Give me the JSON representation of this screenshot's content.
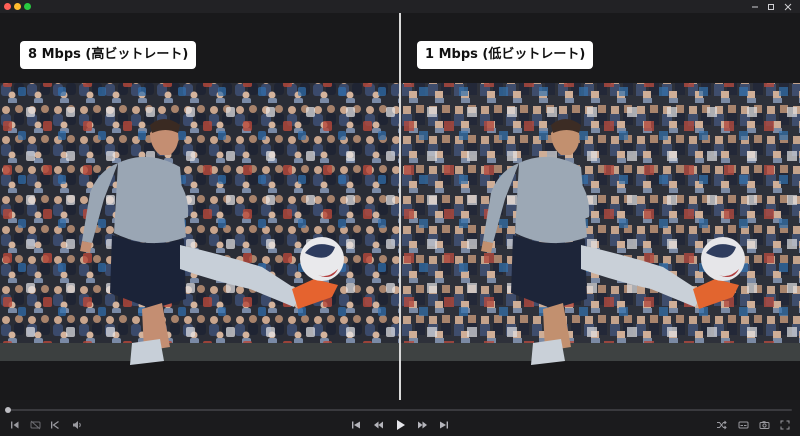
{
  "window": {
    "controls": [
      "minimize-icon",
      "maximize-icon",
      "close-icon"
    ]
  },
  "comparison": {
    "left_label": "8 Mbps (高ビットレート)",
    "right_label": "1 Mbps (低ビットレート)"
  },
  "player": {
    "progress": 0.0,
    "left_controls": [
      "skip-to-start-icon",
      "subtitles-off-icon",
      "previous-frame-icon",
      "volume-icon"
    ],
    "center_controls": [
      "skip-back-icon",
      "rewind-icon",
      "play-icon",
      "fast-forward-icon",
      "skip-forward-icon"
    ],
    "right_controls": [
      "shuffle-icon",
      "captions-icon",
      "screenshot-icon",
      "fullscreen-icon"
    ]
  },
  "colors": {
    "label_background": "#ffffff",
    "label_text": "#111111",
    "player_background": "#1b1b1d",
    "divider": "#d9d9d9"
  }
}
